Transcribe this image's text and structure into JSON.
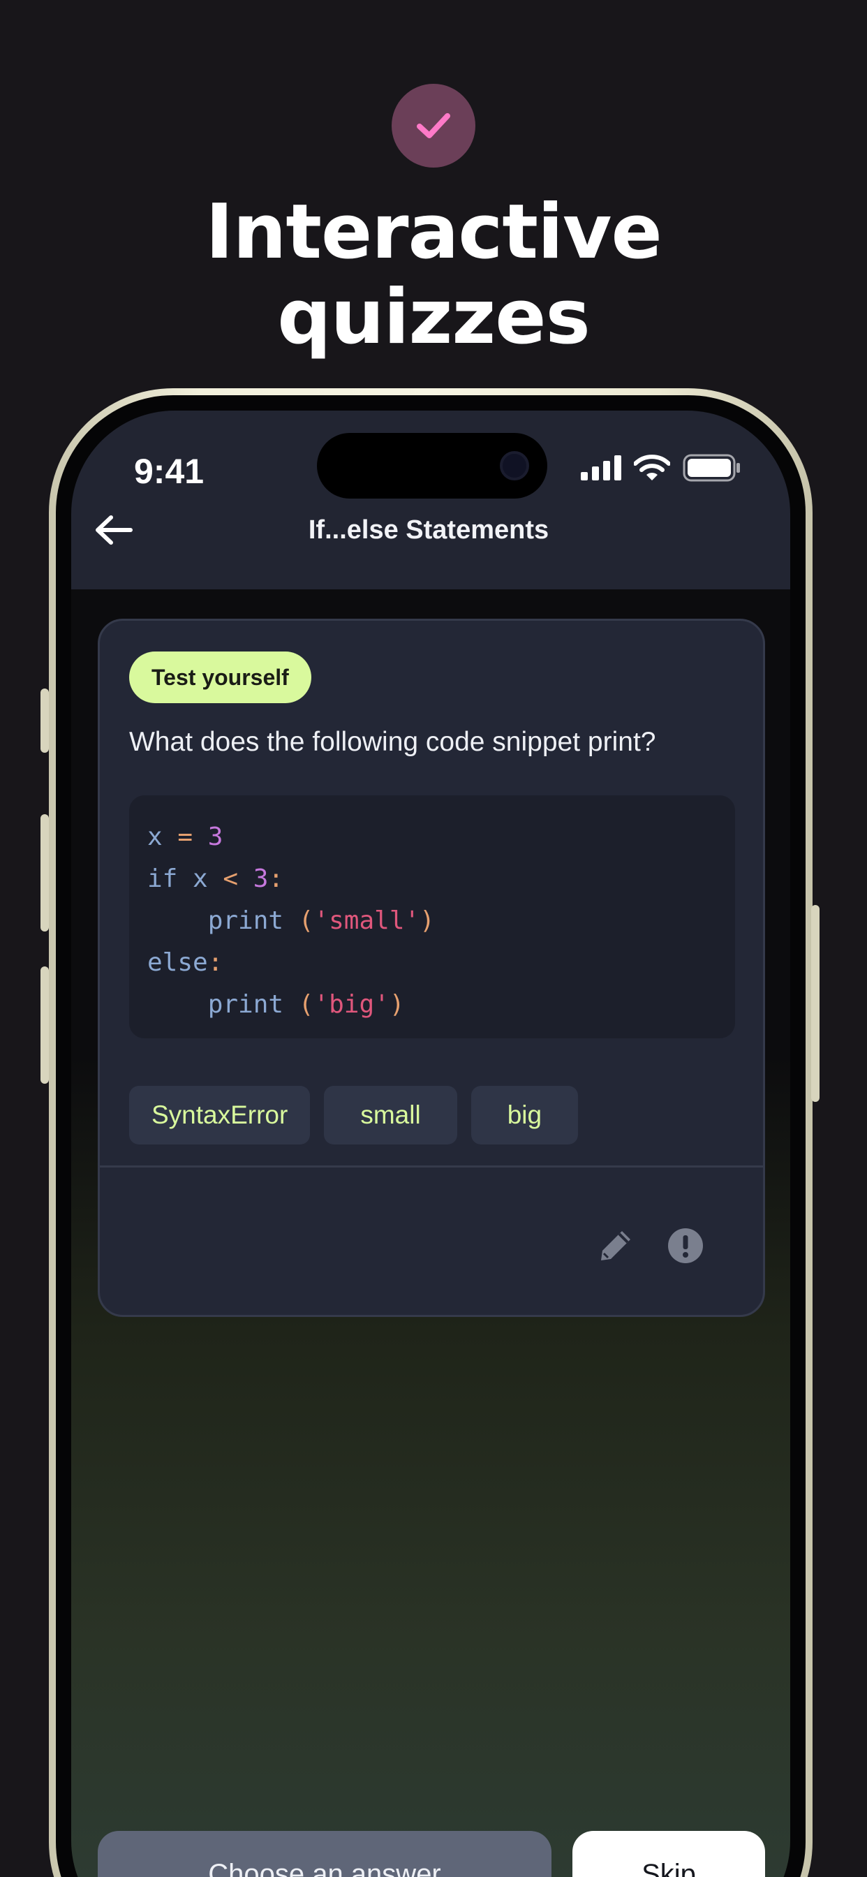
{
  "promo": {
    "title_line1": "Interactive",
    "title_line2": "quizzes",
    "check_icon": "check-icon"
  },
  "status_bar": {
    "time": "9:41",
    "icons": [
      "cellular-signal-icon",
      "wifi-icon",
      "battery-icon"
    ]
  },
  "nav": {
    "back_icon": "arrow-left-icon",
    "title": "If...else Statements"
  },
  "quiz": {
    "badge": "Test yourself",
    "question": "What does the following code snippet print?",
    "code": {
      "line1": {
        "var": "x",
        "op": "=",
        "num": "3"
      },
      "line2": {
        "kw": "if",
        "var": "x",
        "op": "<",
        "num": "3",
        "colon": ":"
      },
      "line3": {
        "fn": "print",
        "open": "(",
        "str": "'small'",
        "close": ")"
      },
      "line4": {
        "kw": "else",
        "colon": ":"
      },
      "line5": {
        "fn": "print",
        "open": "(",
        "str": "'big'",
        "close": ")"
      }
    },
    "options": [
      "SyntaxError",
      "small",
      "big"
    ],
    "actions": [
      "pencil-icon",
      "alert-circle-icon"
    ]
  },
  "footer": {
    "choose_label": "Choose an answer",
    "skip_label": "Skip"
  },
  "colors": {
    "background": "#18161a",
    "accent_lime": "#d9f99d",
    "card": "#232736",
    "topbar": "#222532",
    "check_circle": "#6b3f58",
    "check_mark": "#ff7ac8"
  }
}
